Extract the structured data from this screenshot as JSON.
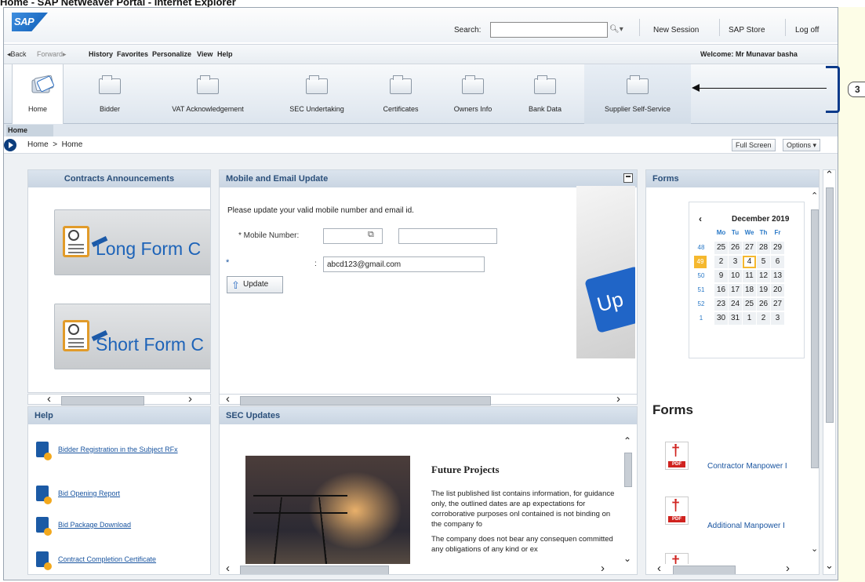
{
  "window": {
    "title": "Home - SAP NetWeaver Portal - Internet Explorer"
  },
  "header": {
    "logo": "SAP",
    "search_label": "Search:",
    "search_value": "",
    "search_icon": "search-icon",
    "links": [
      "New Session",
      "SAP Store",
      "Log off"
    ]
  },
  "menubar": {
    "back": "Back",
    "forward": "Forward",
    "items": [
      "History",
      "Favorites",
      "Personalize",
      "View",
      "Help"
    ],
    "welcome": "Welcome: Mr Munavar basha"
  },
  "nav": {
    "items": [
      "Home",
      "Bidder",
      "VAT Acknowledgement",
      "SEC Undertaking",
      "Certificates",
      "Owners Info",
      "Bank Data",
      "Supplier Self-Service"
    ],
    "selected": "Home",
    "highlighted": "Supplier Self-Service"
  },
  "subtab": {
    "label": "Home"
  },
  "breadcrumb": {
    "text": "Home  >  Home",
    "full_screen": "Full Screen",
    "options": "Options ▾"
  },
  "contracts": {
    "title": "Contracts Announcements",
    "promos": [
      "Long Form C",
      "Short Form C"
    ]
  },
  "help": {
    "title": "Help",
    "links": [
      "Bidder Registration in the Subject RFx",
      "Bid Opening Report",
      "Bid Package Download",
      "Contract Completion Certificate"
    ]
  },
  "mobile": {
    "title": "Mobile and Email Update",
    "instruction": "Please update your valid mobile number and email id.",
    "mobile_label": "* Mobile Number:",
    "mobile_code": "",
    "mobile_value": "",
    "email_marker": "*",
    "email_colon": ":",
    "email_value": "abcd123@gmail.com",
    "update_button": "Update",
    "phone_key_text": "Up"
  },
  "sec": {
    "title": "SEC Updates",
    "article_title": "Future Projects",
    "para1": "The list published list contains information, for guidance only, the outlined dates are ap expectations for corroborative purposes onl contained is not binding on the company fo",
    "para2": "The company does not bear any consequen committed any obligations of any kind or ex"
  },
  "forms": {
    "title": "Forms",
    "calendar": {
      "month": "December 2019",
      "prev": "‹",
      "days_of_week": [
        "Mo",
        "Tu",
        "We",
        "Th",
        "Fr"
      ],
      "weeks": [
        {
          "wk": "48",
          "days": [
            "25",
            "26",
            "27",
            "28",
            "29"
          ]
        },
        {
          "wk": "49",
          "days": [
            "2",
            "3",
            "4",
            "5",
            "6"
          ]
        },
        {
          "wk": "50",
          "days": [
            "9",
            "10",
            "11",
            "12",
            "13"
          ]
        },
        {
          "wk": "51",
          "days": [
            "16",
            "17",
            "18",
            "19",
            "20"
          ]
        },
        {
          "wk": "52",
          "days": [
            "23",
            "24",
            "25",
            "26",
            "27"
          ]
        },
        {
          "wk": "1",
          "days": [
            "30",
            "31",
            "1",
            "2",
            "3"
          ]
        }
      ],
      "today": "4",
      "current_week": "49",
      "today_color": "#f5b82e"
    },
    "section_title": "Forms",
    "links": [
      "Contractor Manpower I",
      "Additional  Manpower I"
    ],
    "pdf_badge": "PDF"
  },
  "callout": {
    "number": "3"
  },
  "colors": {
    "accent": "#2a4f7a",
    "link": "#1a55a0",
    "brand": "#0c5bb5"
  }
}
